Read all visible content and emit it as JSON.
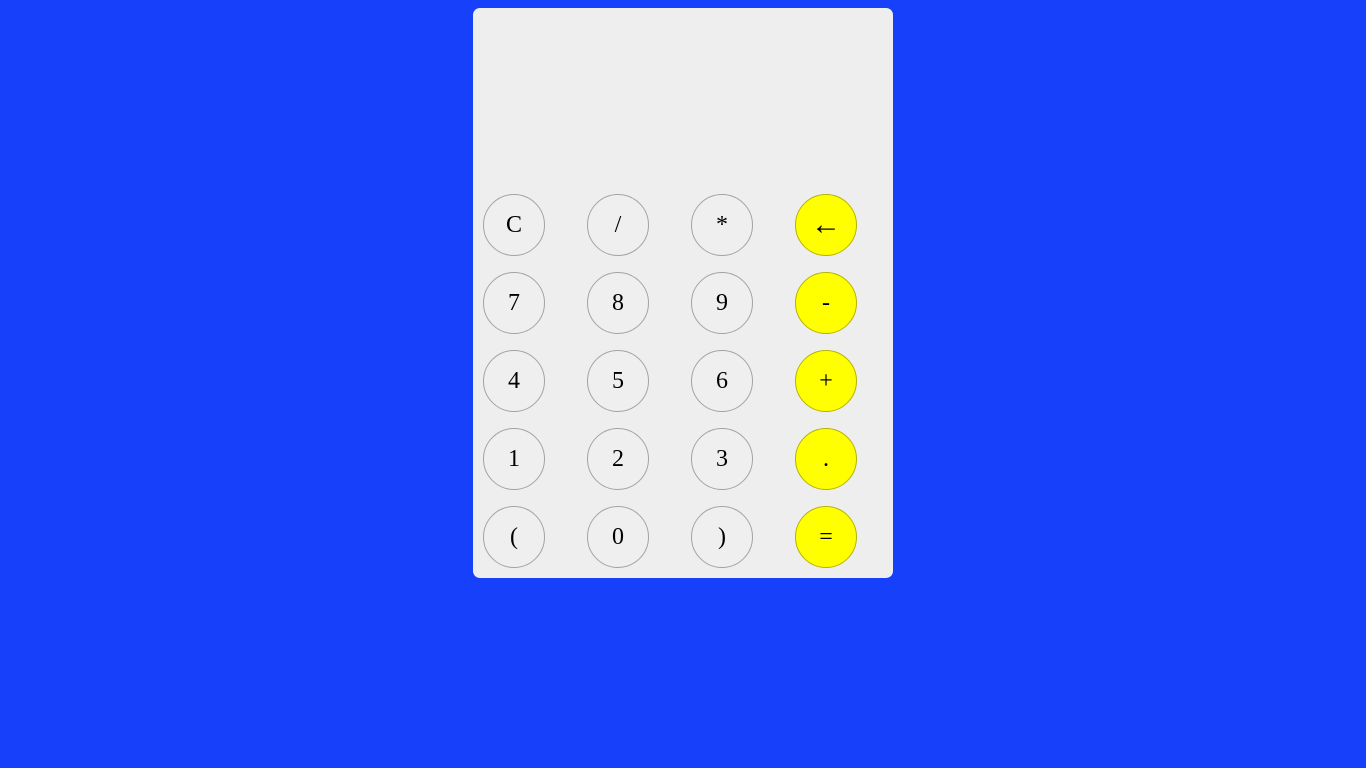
{
  "display": {
    "value": ""
  },
  "colors": {
    "background": "#1740fa",
    "panel": "#eeeeee",
    "operator_key": "#ffff00",
    "key": "#efefef"
  },
  "keys": {
    "clear": "C",
    "divide": "/",
    "multiply": "*",
    "backspace": "←",
    "seven": "7",
    "eight": "8",
    "nine": "9",
    "minus": "-",
    "four": "4",
    "five": "5",
    "six": "6",
    "plus": "+",
    "one": "1",
    "two": "2",
    "three": "3",
    "decimal": ".",
    "open_paren": "(",
    "zero": "0",
    "close_paren": ")",
    "equals": "="
  }
}
